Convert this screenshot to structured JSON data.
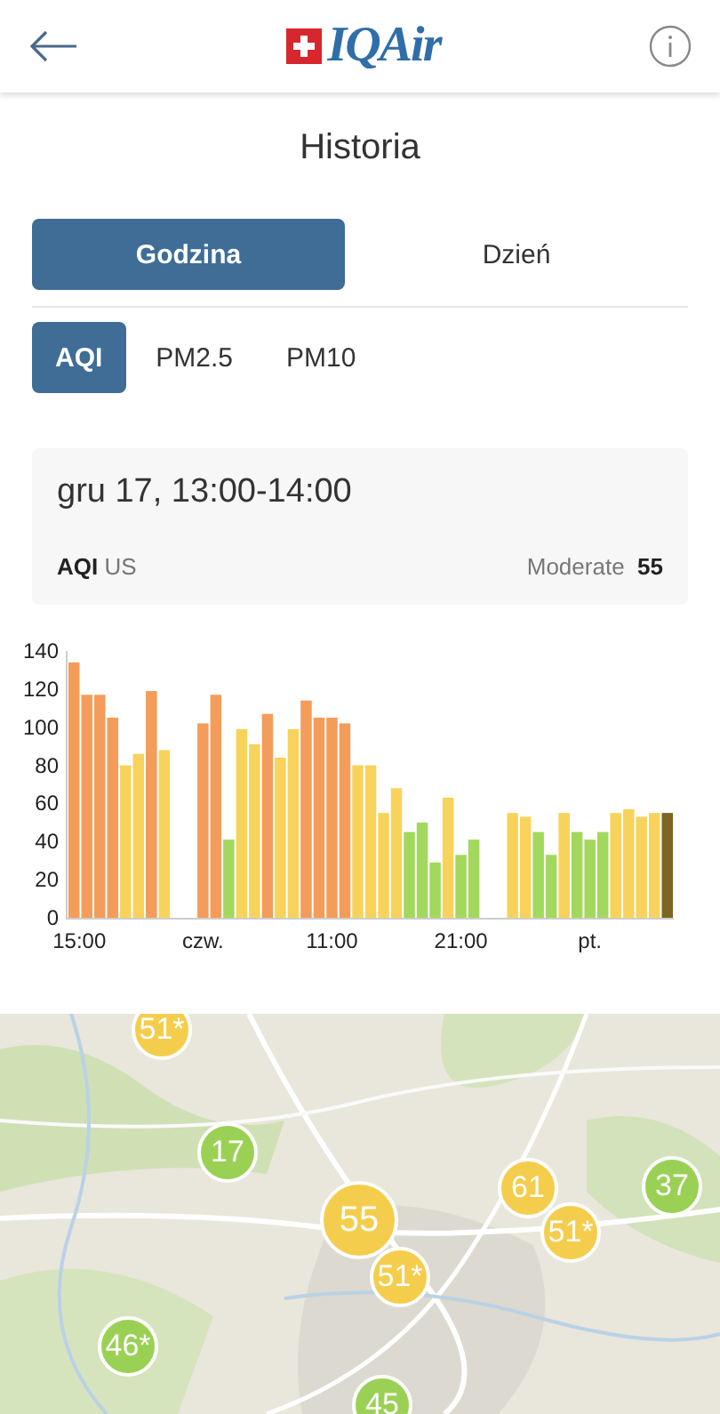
{
  "header": {
    "logo": "IQAir"
  },
  "title": "Historia",
  "period_tabs": [
    {
      "label": "Godzina",
      "selected": true
    },
    {
      "label": "Dzień",
      "selected": false
    }
  ],
  "pollutant_tabs": [
    {
      "label": "AQI",
      "selected": true
    },
    {
      "label": "PM2.5",
      "selected": false
    },
    {
      "label": "PM10",
      "selected": false
    }
  ],
  "detail_card": {
    "time": "gru 17, 13:00-14:00",
    "metric": "AQI",
    "standard": "US",
    "category": "Moderate",
    "value": "55"
  },
  "chart_data": {
    "type": "bar",
    "stacked": true,
    "categories": [
      "15:00",
      null,
      null,
      null,
      null,
      null,
      null,
      null,
      null,
      null,
      "czw.",
      null,
      null,
      null,
      null,
      null,
      null,
      null,
      null,
      null,
      "11:00",
      null,
      null,
      null,
      null,
      null,
      null,
      null,
      null,
      null,
      "21:00",
      null,
      null,
      null,
      null,
      null,
      null,
      null,
      null,
      null,
      "pt.",
      null,
      null,
      null,
      null,
      null,
      null
    ],
    "series": [
      {
        "color": "#f49c5a",
        "values": [
          134,
          117,
          117,
          105,
          null,
          null,
          119,
          null,
          null,
          null,
          102,
          117,
          null,
          null,
          null,
          107,
          null,
          null,
          114,
          105,
          105,
          102,
          null,
          null,
          null,
          null,
          null,
          null,
          null,
          null,
          null,
          null,
          null,
          null,
          null,
          null,
          null,
          null,
          null,
          null,
          null,
          null,
          null,
          null,
          null,
          null,
          null
        ]
      },
      {
        "color": "#f8d35b",
        "values": [
          null,
          null,
          null,
          null,
          80,
          86,
          null,
          88,
          null,
          null,
          null,
          null,
          null,
          99,
          91,
          null,
          84,
          99,
          null,
          null,
          null,
          null,
          80,
          80,
          55,
          68,
          null,
          null,
          null,
          63,
          null,
          null,
          null,
          null,
          55,
          53,
          null,
          null,
          55,
          null,
          null,
          null,
          55,
          57,
          53,
          55,
          null
        ]
      },
      {
        "color": "#a2d85d",
        "values": [
          null,
          null,
          null,
          null,
          null,
          null,
          null,
          null,
          null,
          null,
          null,
          null,
          41,
          null,
          null,
          null,
          null,
          null,
          null,
          null,
          null,
          null,
          null,
          null,
          null,
          null,
          45,
          50,
          29,
          null,
          33,
          41,
          null,
          null,
          null,
          null,
          45,
          33,
          null,
          45,
          41,
          45,
          null,
          null,
          null,
          null,
          null
        ]
      },
      {
        "color": "#7d6524",
        "values": [
          null,
          null,
          null,
          null,
          null,
          null,
          null,
          null,
          null,
          null,
          null,
          null,
          null,
          null,
          null,
          null,
          null,
          null,
          null,
          null,
          null,
          null,
          null,
          null,
          null,
          null,
          null,
          null,
          null,
          null,
          null,
          null,
          null,
          null,
          null,
          null,
          null,
          null,
          null,
          null,
          null,
          null,
          null,
          null,
          null,
          null,
          55
        ]
      }
    ],
    "ylim": [
      0,
      140
    ],
    "yticks": [
      0,
      20,
      40,
      60,
      80,
      100,
      120,
      140
    ]
  },
  "map": {
    "kind": "picture",
    "markers": [
      {
        "value": "51*",
        "color": "#f5cd4c"
      },
      {
        "value": "17",
        "color": "#9ad155"
      },
      {
        "value": "55",
        "color": "#f5cd4c"
      },
      {
        "value": "51*",
        "color": "#f5cd4c"
      },
      {
        "value": "61",
        "color": "#f5cd4c"
      },
      {
        "value": "51*",
        "color": "#f5cd4c"
      },
      {
        "value": "37",
        "color": "#9ad155"
      },
      {
        "value": "46*",
        "color": "#9ad155"
      },
      {
        "value": "45",
        "color": "#9ad155"
      }
    ]
  }
}
